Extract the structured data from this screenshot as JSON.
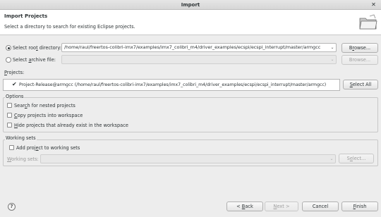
{
  "window": {
    "title": "Import"
  },
  "header": {
    "title": "Import Projects",
    "description": "Select a directory to search for existing Eclipse projects."
  },
  "source": {
    "root_dir_label": "Select root directory:",
    "root_dir_value": "/home/raul/freertos-colibri-imx7/examples/imx7_colibri_m4/driver_examples/ecspi/ecspi_interrupt/master/armgcc",
    "root_browse_label": "Browse...",
    "archive_label": "Select archive file:",
    "archive_value": "",
    "archive_browse_label": "Browse...",
    "selected": "root_directory"
  },
  "projects": {
    "label": "Projects:",
    "items": [
      {
        "name": "Project-Release@armgcc (/home/raul/freertos-colibri-imx7/examples/imx7_colibri_m4/driver_examples/ecspi/ecspi_interrupt/master/armgcc)",
        "checked": true
      }
    ],
    "select_all_label": "Select All"
  },
  "options": {
    "title": "Options",
    "search_nested": "Search for nested projects",
    "copy_projects": "Copy projects into workspace",
    "hide_existing": "Hide projects that already exist in the workspace"
  },
  "working_sets": {
    "title": "Working sets",
    "add_label": "Add project to working sets",
    "sets_label": "Working sets:",
    "sets_value": "",
    "select_label": "Select..."
  },
  "footer": {
    "back_label": "< Back",
    "next_label": "Next >",
    "cancel_label": "Cancel",
    "finish_label": "Finish"
  }
}
